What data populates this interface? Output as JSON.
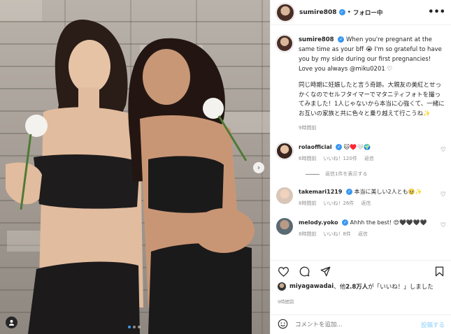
{
  "header": {
    "username": "sumire808",
    "separator": "•",
    "follow_label": "フォロー中",
    "more_label": "•••"
  },
  "caption": {
    "username": "sumire808",
    "text_en": "When you're pregnant at the same time as your bff 😭 I'm so grateful to have you by my side during our first pregnancies! Love you always @miku0201 ♡",
    "text_jp": "同じ時期に妊娠したと言う奇跡。大親友の美紅とせっかくなのでセルフタイマーでマタニティフォトを撮ってみました！1人じゃないから本当に心強くて、一緒にお互いの家族と共に色々と乗り越えて行こうね✨",
    "time": "9時間前"
  },
  "comments": [
    {
      "username": "rolaofficial",
      "text": "🐱♥️🤍🌍",
      "time": "6時間前",
      "likes": "いいね！120件",
      "reply": "返信",
      "show_replies": "返信1件を表示する"
    },
    {
      "username": "takemari1219",
      "text": "本当に美しい2人とも🥹✨",
      "time": "8時間前",
      "likes": "いいね！26件",
      "reply": "返信"
    },
    {
      "username": "melody.yoko",
      "text": "Ahhh the best! 😍🖤🖤🖤🖤",
      "time": "8時間前",
      "likes": "いいね！8件",
      "reply": "返信"
    }
  ],
  "likes_line": {
    "user": "miyagawadai",
    "middle": "、他",
    "count": "2.8万人",
    "suffix": "が「いいね！」しました"
  },
  "posted_time": "9時間前",
  "add_comment": {
    "placeholder": "コメントを追加...",
    "post_label": "投稿する"
  },
  "colors": {
    "verified": "#3897f0",
    "post_button": "#b2dffc",
    "meta_text": "#8e8e8e"
  }
}
